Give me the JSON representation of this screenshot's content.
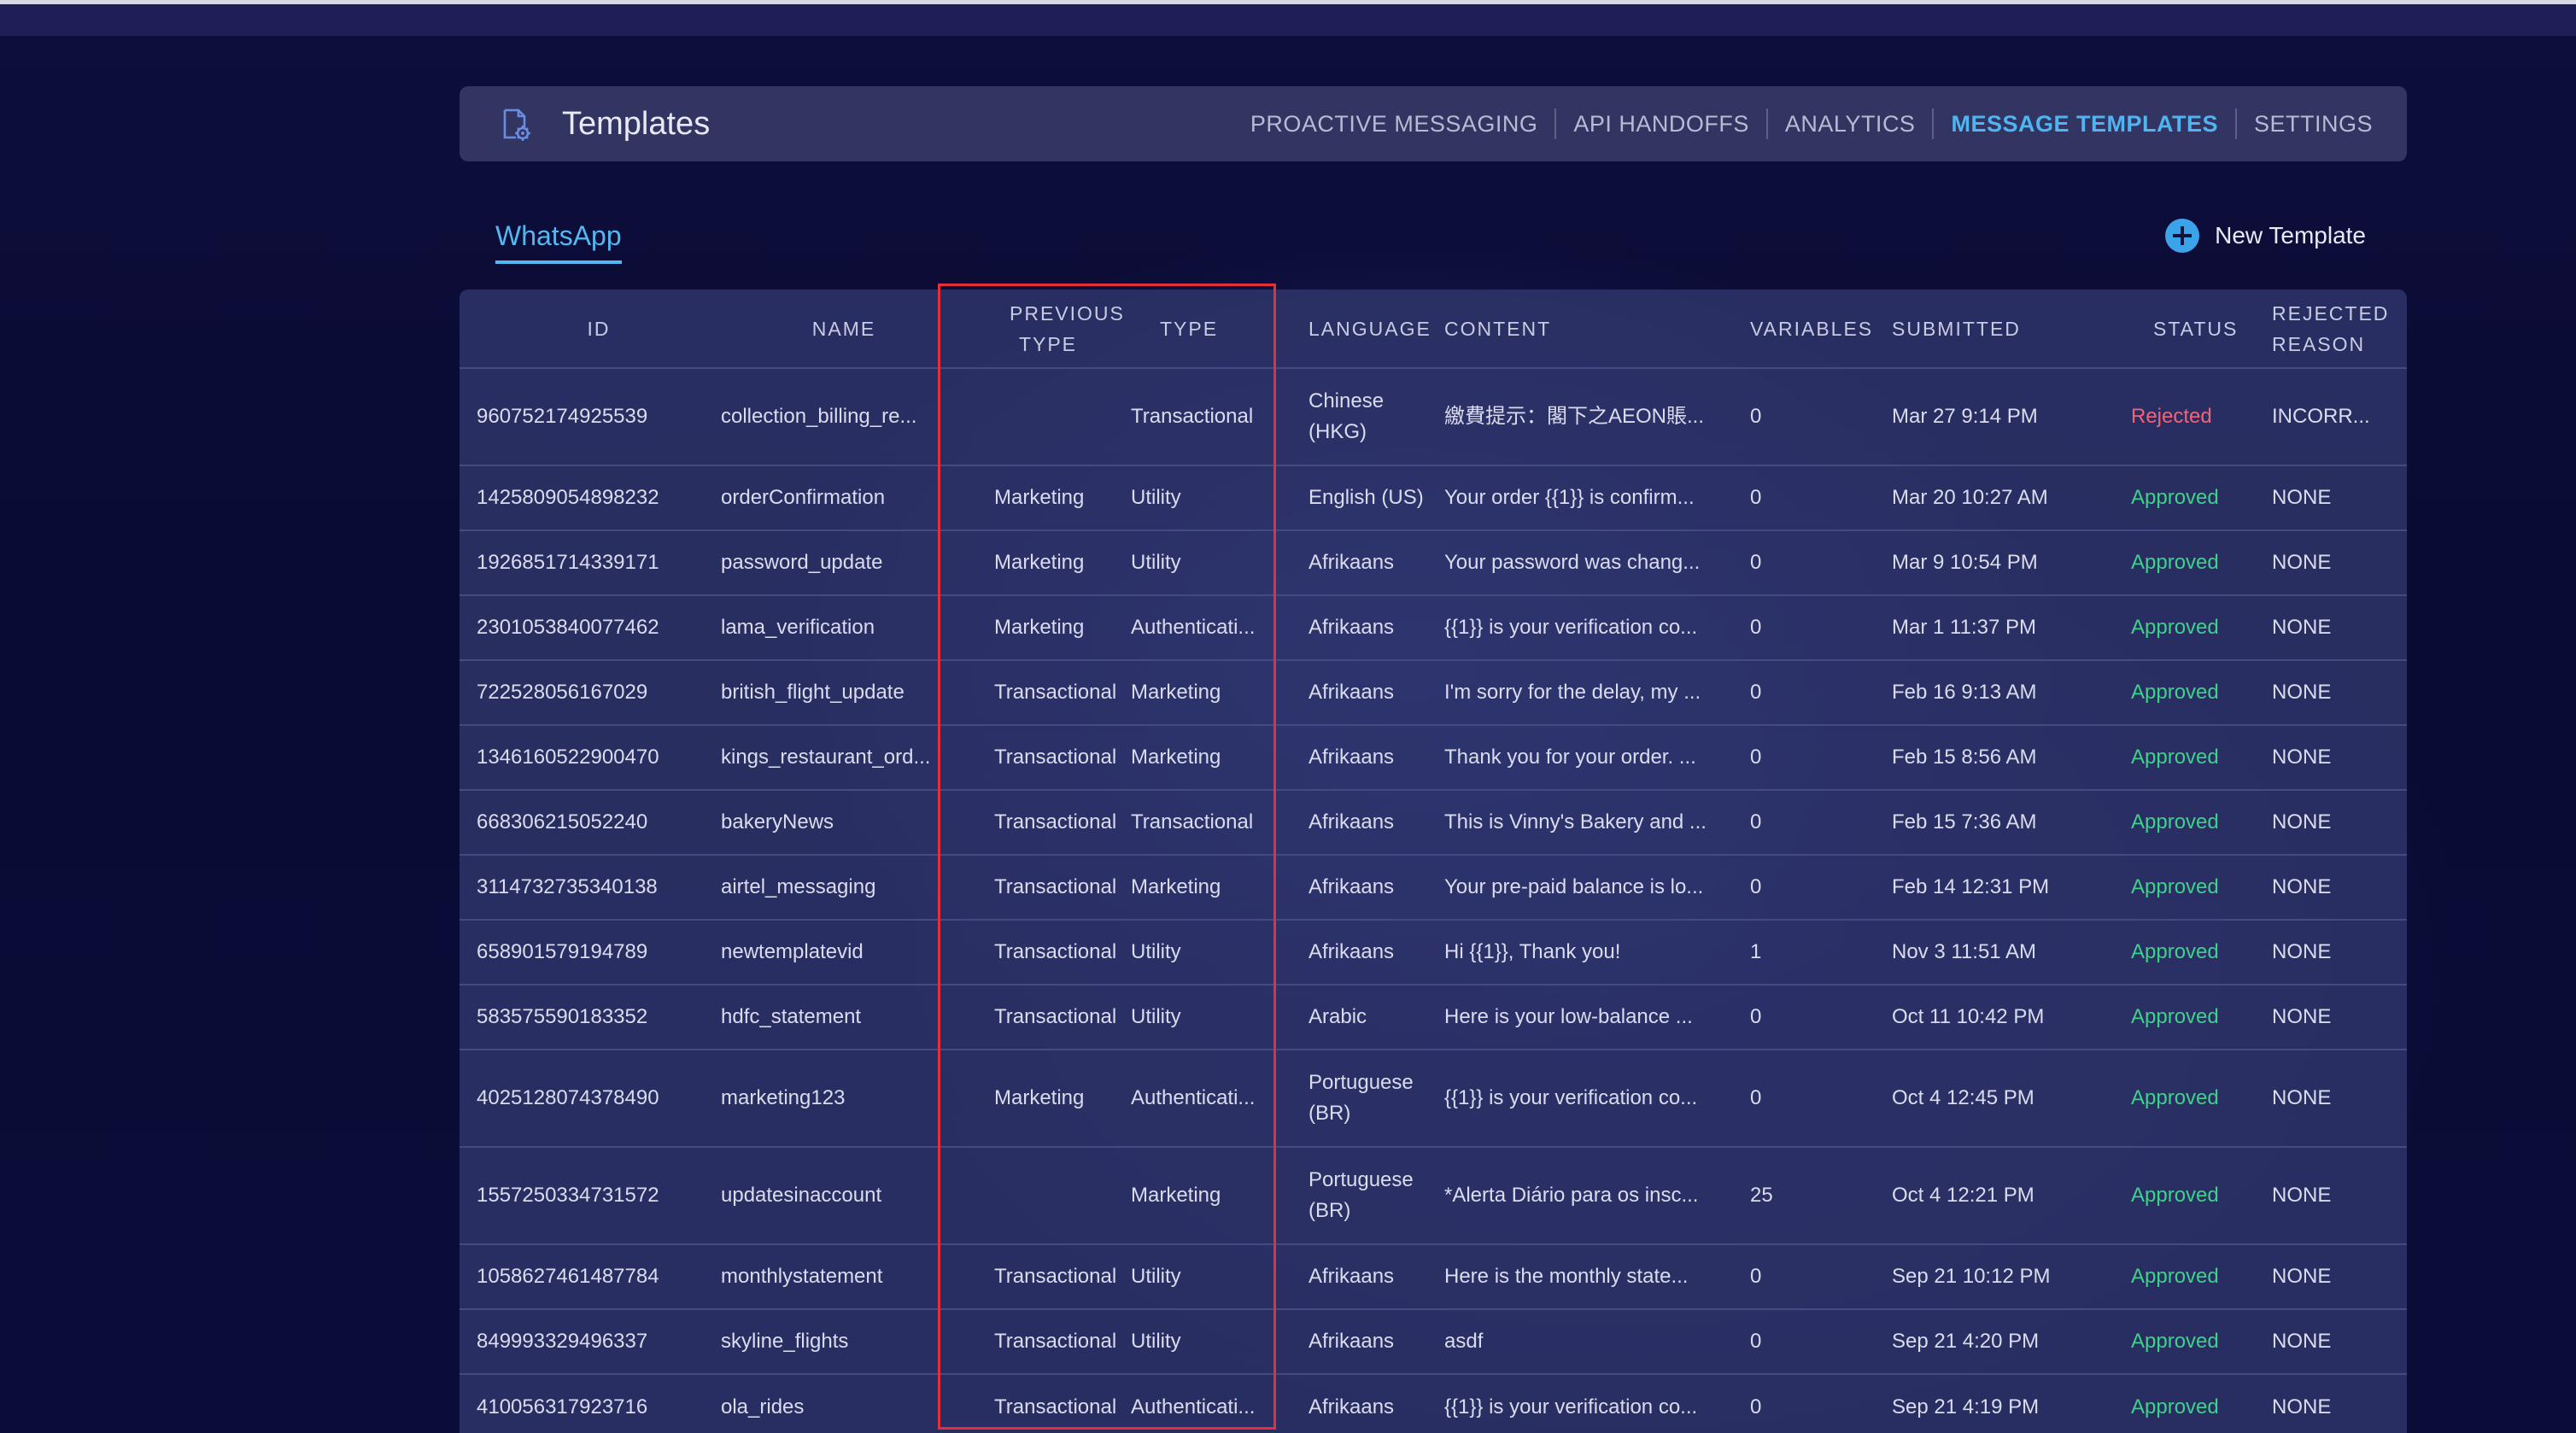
{
  "header": {
    "title": "Templates",
    "tabs": [
      {
        "label": "PROACTIVE MESSAGING",
        "active": false
      },
      {
        "label": "API HANDOFFS",
        "active": false
      },
      {
        "label": "ANALYTICS",
        "active": false
      },
      {
        "label": "MESSAGE TEMPLATES",
        "active": true
      },
      {
        "label": "SETTINGS",
        "active": false
      }
    ]
  },
  "channel_tab": "WhatsApp",
  "new_template_label": "New Template",
  "table": {
    "columns": [
      "ID",
      "NAME",
      "PREVIOUS TYPE",
      "TYPE",
      "LANGUAGE",
      "CONTENT",
      "VARIABLES",
      "SUBMITTED",
      "STATUS",
      "REJECTED REASON"
    ],
    "rows": [
      {
        "id": "960752174925539",
        "name": "collection_billing_re...",
        "previous_type": "",
        "type": "Transactional",
        "language": "Chinese (HKG)",
        "content": "繳費提示：閣下之AEON賬...",
        "variables": "0",
        "submitted": "Mar 27 9:14 PM",
        "status": "Rejected",
        "reason": "INCORR..."
      },
      {
        "id": "1425809054898232",
        "name": "orderConfirmation",
        "previous_type": "Marketing",
        "type": "Utility",
        "language": "English (US)",
        "content": "Your order {{1}} is confirm...",
        "variables": "0",
        "submitted": "Mar 20 10:27 AM",
        "status": "Approved",
        "reason": "NONE"
      },
      {
        "id": "1926851714339171",
        "name": "password_update",
        "previous_type": "Marketing",
        "type": "Utility",
        "language": "Afrikaans",
        "content": "Your password was chang...",
        "variables": "0",
        "submitted": "Mar 9 10:54 PM",
        "status": "Approved",
        "reason": "NONE"
      },
      {
        "id": "2301053840077462",
        "name": "lama_verification",
        "previous_type": "Marketing",
        "type": "Authenticati...",
        "language": "Afrikaans",
        "content": "{{1}} is your verification co...",
        "variables": "0",
        "submitted": "Mar 1 11:37 PM",
        "status": "Approved",
        "reason": "NONE"
      },
      {
        "id": "722528056167029",
        "name": "british_flight_update",
        "previous_type": "Transactional",
        "type": "Marketing",
        "language": "Afrikaans",
        "content": "I'm sorry for the delay, my ...",
        "variables": "0",
        "submitted": "Feb 16 9:13 AM",
        "status": "Approved",
        "reason": "NONE"
      },
      {
        "id": "1346160522900470",
        "name": "kings_restaurant_ord...",
        "previous_type": "Transactional",
        "type": "Marketing",
        "language": "Afrikaans",
        "content": "Thank you for your order. ...",
        "variables": "0",
        "submitted": "Feb 15 8:56 AM",
        "status": "Approved",
        "reason": "NONE"
      },
      {
        "id": "668306215052240",
        "name": "bakeryNews",
        "previous_type": "Transactional",
        "type": "Transactional",
        "language": "Afrikaans",
        "content": "This is Vinny's Bakery and ...",
        "variables": "0",
        "submitted": "Feb 15 7:36 AM",
        "status": "Approved",
        "reason": "NONE"
      },
      {
        "id": "3114732735340138",
        "name": "airtel_messaging",
        "previous_type": "Transactional",
        "type": "Marketing",
        "language": "Afrikaans",
        "content": "Your pre-paid balance is lo...",
        "variables": "0",
        "submitted": "Feb 14 12:31 PM",
        "status": "Approved",
        "reason": "NONE"
      },
      {
        "id": "658901579194789",
        "name": "newtemplatevid",
        "previous_type": "Transactional",
        "type": "Utility",
        "language": "Afrikaans",
        "content": "Hi {{1}}, Thank you!",
        "variables": "1",
        "submitted": "Nov 3 11:51 AM",
        "status": "Approved",
        "reason": "NONE"
      },
      {
        "id": "583575590183352",
        "name": "hdfc_statement",
        "previous_type": "Transactional",
        "type": "Utility",
        "language": "Arabic",
        "content": "Here is your low-balance ...",
        "variables": "0",
        "submitted": "Oct 11 10:42 PM",
        "status": "Approved",
        "reason": "NONE"
      },
      {
        "id": "4025128074378490",
        "name": "marketing123",
        "previous_type": "Marketing",
        "type": "Authenticati...",
        "language": "Portuguese (BR)",
        "content": "{{1}} is your verification co...",
        "variables": "0",
        "submitted": "Oct 4 12:45 PM",
        "status": "Approved",
        "reason": "NONE"
      },
      {
        "id": "1557250334731572",
        "name": "updatesinaccount",
        "previous_type": "",
        "type": "Marketing",
        "language": "Portuguese (BR)",
        "content": "*Alerta Diário para os insc...",
        "variables": "25",
        "submitted": "Oct 4 12:21 PM",
        "status": "Approved",
        "reason": "NONE"
      },
      {
        "id": "1058627461487784",
        "name": "monthlystatement",
        "previous_type": "Transactional",
        "type": "Utility",
        "language": "Afrikaans",
        "content": "Here is the monthly state...",
        "variables": "0",
        "submitted": "Sep 21 10:12 PM",
        "status": "Approved",
        "reason": "NONE"
      },
      {
        "id": "849993329496337",
        "name": "skyline_flights",
        "previous_type": "Transactional",
        "type": "Utility",
        "language": "Afrikaans",
        "content": "asdf",
        "variables": "0",
        "submitted": "Sep 21 4:20 PM",
        "status": "Approved",
        "reason": "NONE"
      },
      {
        "id": "410056317923716",
        "name": "ola_rides",
        "previous_type": "Transactional",
        "type": "Authenticati...",
        "language": "Afrikaans",
        "content": "{{1}} is your verification co...",
        "variables": "0",
        "submitted": "Sep 21 4:19 PM",
        "status": "Approved",
        "reason": "NONE"
      }
    ]
  },
  "colors": {
    "accent": "#4fb4f0",
    "approved": "#3fd18b",
    "rejected": "#f0647a",
    "highlight_box": "#e5303b"
  }
}
